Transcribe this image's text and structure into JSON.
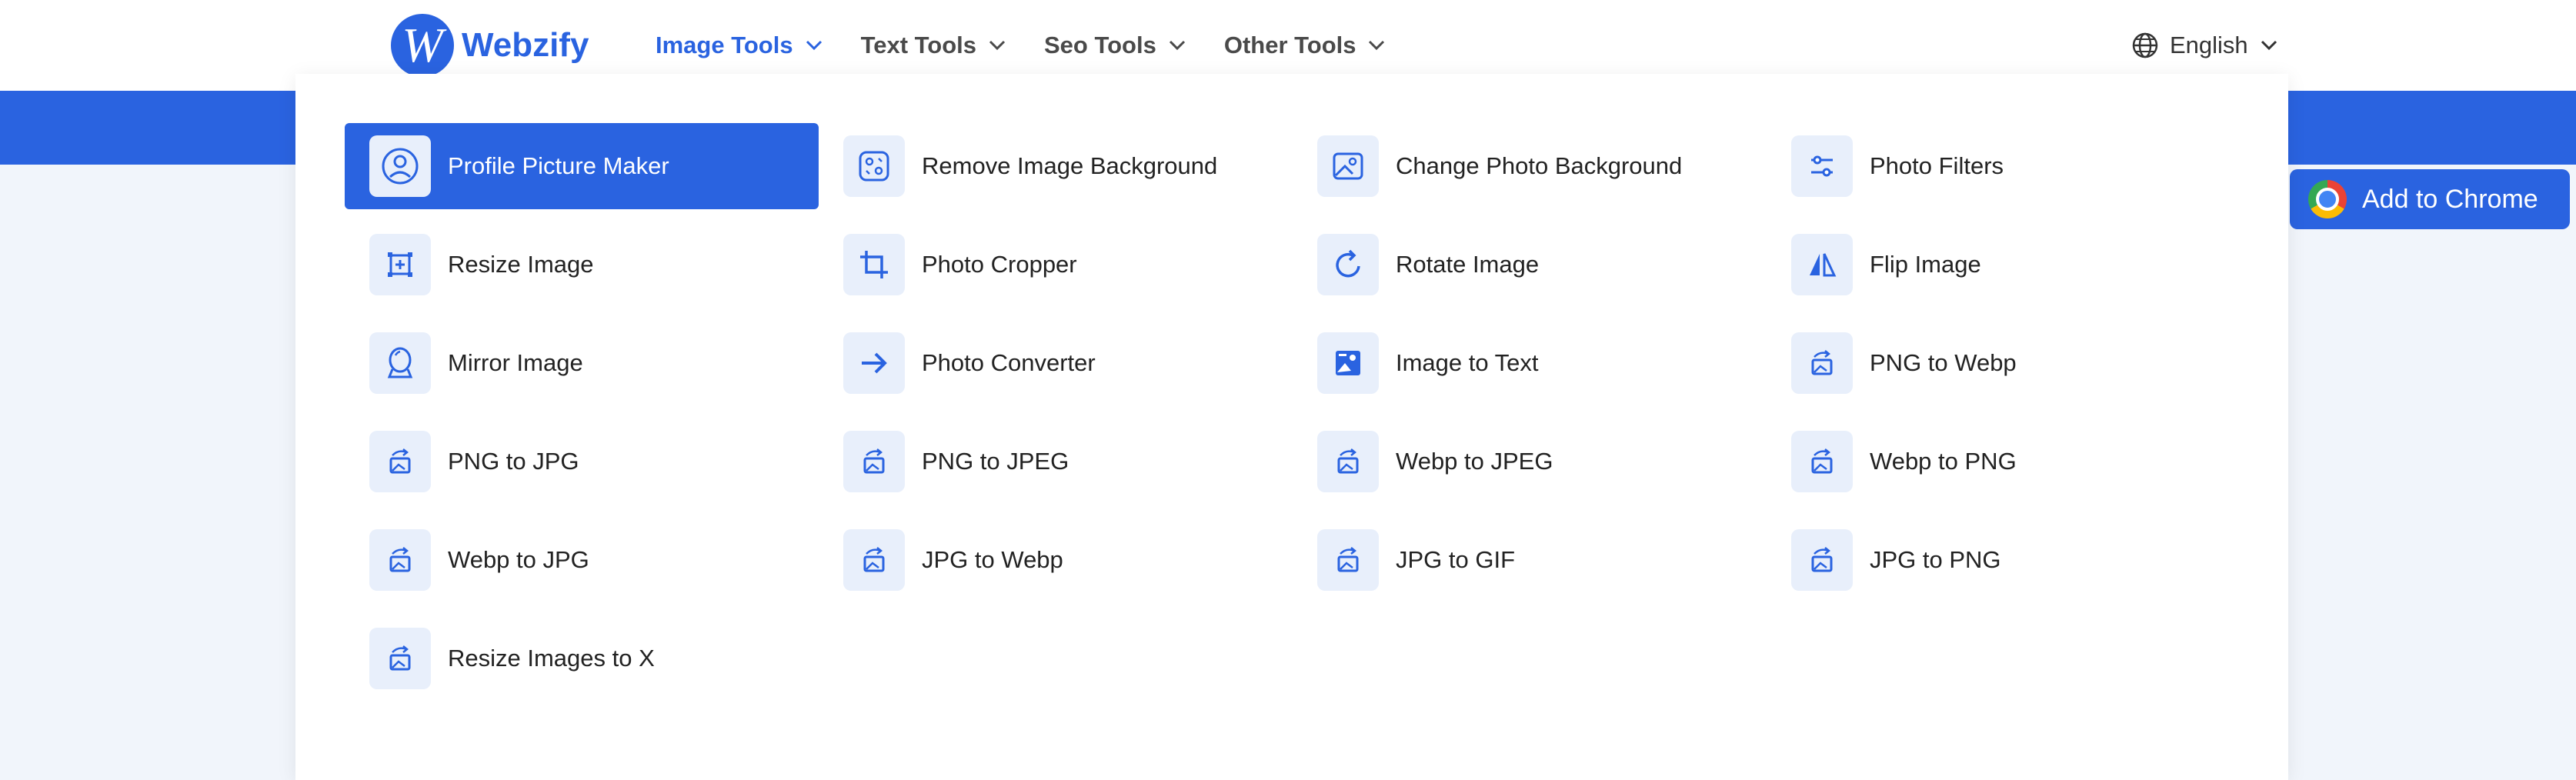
{
  "header": {
    "logo_text": "Webzify",
    "logo_letter": "W",
    "nav": [
      {
        "label": "Image Tools",
        "active": true
      },
      {
        "label": "Text Tools",
        "active": false
      },
      {
        "label": "Seo Tools",
        "active": false
      },
      {
        "label": "Other Tools",
        "active": false
      }
    ],
    "language": "English"
  },
  "chrome_button": {
    "label": "Add to Chrome"
  },
  "menu": {
    "items": [
      {
        "label": "Profile Picture Maker",
        "icon": "profile-icon",
        "active": true
      },
      {
        "label": "Remove Image Background",
        "icon": "magic-eraser-icon"
      },
      {
        "label": "Change Photo Background",
        "icon": "image-icon"
      },
      {
        "label": "Photo Filters",
        "icon": "sliders-icon"
      },
      {
        "label": "Resize Image",
        "icon": "resize-icon"
      },
      {
        "label": "Photo Cropper",
        "icon": "crop-icon"
      },
      {
        "label": "Rotate Image",
        "icon": "rotate-icon"
      },
      {
        "label": "Flip Image",
        "icon": "flip-icon"
      },
      {
        "label": "Mirror Image",
        "icon": "mirror-icon"
      },
      {
        "label": "Photo Converter",
        "icon": "arrow-right-icon"
      },
      {
        "label": "Image to Text",
        "icon": "image-text-icon"
      },
      {
        "label": "PNG to Webp",
        "icon": "convert-image-icon"
      },
      {
        "label": "PNG to JPG",
        "icon": "convert-image-icon"
      },
      {
        "label": "PNG to JPEG",
        "icon": "convert-image-icon"
      },
      {
        "label": "Webp to JPEG",
        "icon": "convert-image-icon"
      },
      {
        "label": "Webp to PNG",
        "icon": "convert-image-icon"
      },
      {
        "label": "Webp to JPG",
        "icon": "convert-image-icon"
      },
      {
        "label": "JPG to Webp",
        "icon": "convert-image-icon"
      },
      {
        "label": "JPG to GIF",
        "icon": "convert-image-icon"
      },
      {
        "label": "JPG to PNG",
        "icon": "convert-image-icon"
      },
      {
        "label": "Resize Images to X",
        "icon": "convert-image-icon"
      }
    ]
  },
  "colors": {
    "accent": "#2a63e0",
    "icon_bg": "#e8effb",
    "page_bg": "#f1f5fb"
  }
}
